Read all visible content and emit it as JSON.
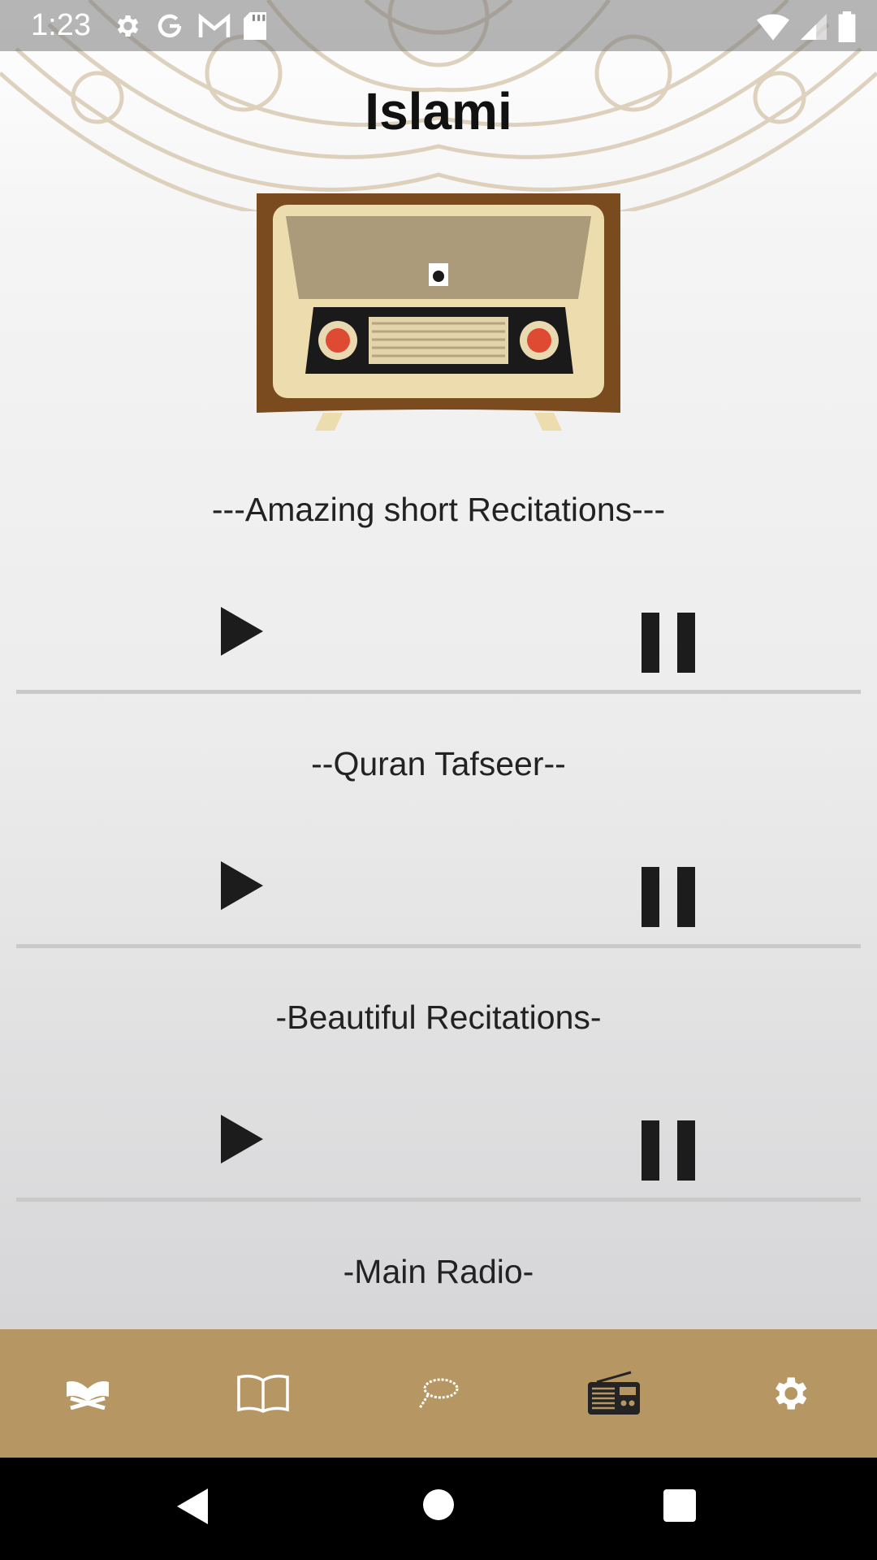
{
  "status_bar": {
    "time": "1:23",
    "left_icons": [
      "settings-icon",
      "google-icon",
      "gmail-icon",
      "sd-card-icon"
    ],
    "right_icons": [
      "wifi-icon",
      "signal-icon",
      "battery-icon"
    ]
  },
  "app": {
    "title": "Islami"
  },
  "radio_image": "radio-illustration",
  "stations": [
    {
      "title": "---Amazing short Recitations---"
    },
    {
      "title": "--Quran Tafseer--"
    },
    {
      "title": "-Beautiful Recitations-"
    },
    {
      "title": "-Main Radio-"
    }
  ],
  "bottom_nav": {
    "items": [
      {
        "icon": "quran-icon"
      },
      {
        "icon": "hadith-book-icon"
      },
      {
        "icon": "sebha-icon"
      },
      {
        "icon": "radio-icon",
        "active": true
      },
      {
        "icon": "settings-icon"
      }
    ],
    "background": "#b69764",
    "active_color": "#242424",
    "inactive_color": "#ffffff"
  },
  "system_nav": {
    "icons": [
      "back-icon",
      "home-icon",
      "recents-icon"
    ]
  }
}
